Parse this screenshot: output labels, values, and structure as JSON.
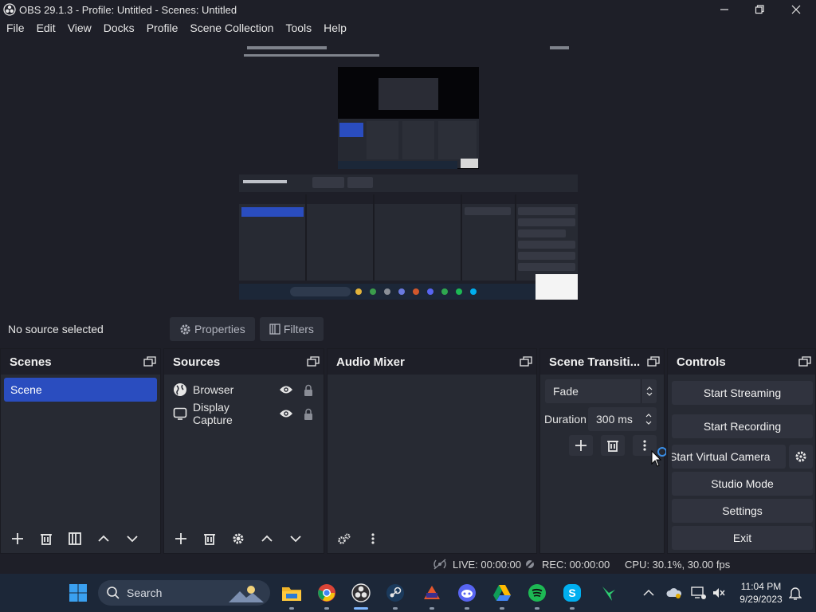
{
  "window": {
    "title": "OBS 29.1.3 - Profile: Untitled - Scenes: Untitled"
  },
  "menu": [
    "File",
    "Edit",
    "View",
    "Docks",
    "Profile",
    "Scene Collection",
    "Tools",
    "Help"
  ],
  "source_toolbar": {
    "no_source": "No source selected",
    "properties": "Properties",
    "filters": "Filters"
  },
  "docks": {
    "scenes": {
      "title": "Scenes",
      "items": [
        "Scene"
      ]
    },
    "sources": {
      "title": "Sources",
      "items": [
        "Browser",
        "Display Capture"
      ]
    },
    "audio_mixer": {
      "title": "Audio Mixer"
    },
    "transitions": {
      "title": "Scene Transiti...",
      "selected": "Fade",
      "duration_label": "Duration",
      "duration_value": "300 ms"
    },
    "controls": {
      "title": "Controls",
      "start_streaming": "Start Streaming",
      "start_recording": "Start Recording",
      "start_virtual_camera": "Start Virtual Camera",
      "studio_mode": "Studio Mode",
      "settings": "Settings",
      "exit": "Exit"
    }
  },
  "status": {
    "live": "LIVE: 00:00:00",
    "rec": "REC: 00:00:00",
    "cpu": "CPU: 30.1%, 30.00 fps"
  },
  "taskbar": {
    "search_label": "Search",
    "time": "11:04 PM",
    "date": "9/29/2023"
  },
  "colors": {
    "background": "#1e1f28",
    "dock": "#272a33",
    "selected": "#2a4dbf",
    "taskbar": "#1c2738"
  }
}
